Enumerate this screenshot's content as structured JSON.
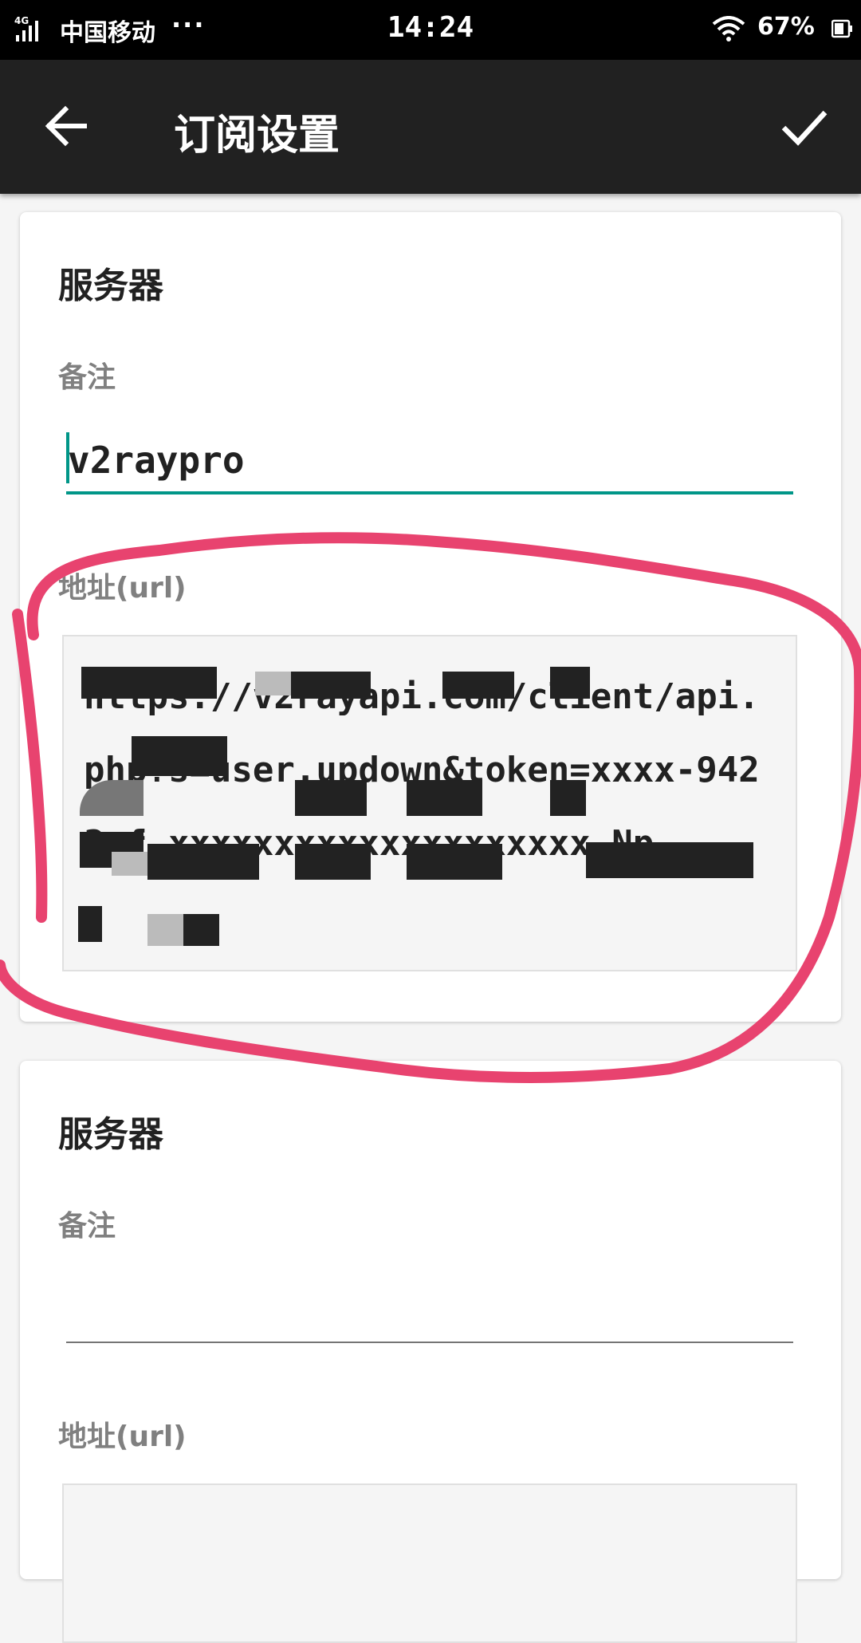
{
  "status_bar": {
    "network": "4G",
    "carrier": "中国移动",
    "more": "···",
    "time": "14:24",
    "battery": "67%"
  },
  "app_bar": {
    "title": "订阅设置",
    "back_icon": "arrow-left-icon",
    "confirm_icon": "check-icon"
  },
  "servers": [
    {
      "heading": "服务器",
      "remark_label": "备注",
      "remark_value": "v2raypro",
      "url_label": "地址(url)",
      "url_value": "https://v2rayapi.com/client/api.php?s=user.updown&token=xxxx-9423-f xxxxxxxxxxxxxxxxxxxx Np"
    },
    {
      "heading": "服务器",
      "remark_label": "备注",
      "remark_value": "",
      "url_label": "地址(url)",
      "url_value": ""
    }
  ],
  "annotation_color": "#e8436f"
}
